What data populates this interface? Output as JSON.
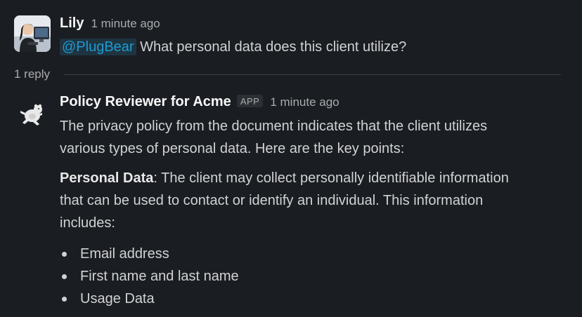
{
  "message1": {
    "sender": "Lily",
    "time": "1 minute ago",
    "mention": "@PlugBear",
    "text": "What personal data does this client utilize?",
    "avatar_icon": "person-at-computer-avatar"
  },
  "thread": {
    "reply_count": "1 reply"
  },
  "message2": {
    "sender": "Policy Reviewer for Acme",
    "badge": "APP",
    "time": "1 minute ago",
    "avatar_icon": "running-bear-icon",
    "intro_line1": "The privacy policy from the document indicates that the client utilizes",
    "intro_line2": "various types of personal data. Here are the key points:",
    "section_label": "Personal Data",
    "section_text_line1": ": The client may collect personally identifiable information",
    "section_text_line2": "that can be used to contact or identify an individual. This information",
    "section_text_line3": "includes:",
    "bullets": [
      "Email address",
      "First name and last name",
      "Usage Data"
    ]
  },
  "colors": {
    "background": "#1a1d21",
    "mention": "#1d9bd1",
    "mention_bg": "#1e3441",
    "text": "#d1d2d3",
    "muted": "#ababad"
  }
}
